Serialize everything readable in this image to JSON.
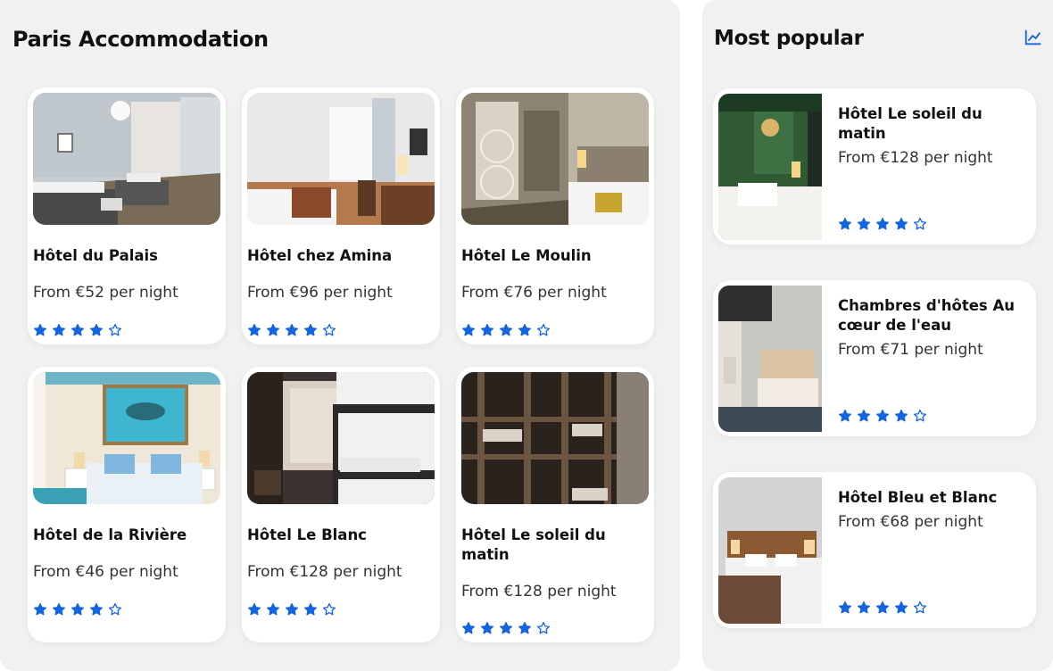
{
  "accent_color": "#1565e0",
  "main": {
    "title": "Paris Accommodation",
    "hotels": [
      {
        "name": "Hôtel du Palais",
        "price": "From €52 per night",
        "rating": 4,
        "max_rating": 5
      },
      {
        "name": "Hôtel chez Amina",
        "price": "From €96 per night",
        "rating": 4,
        "max_rating": 5
      },
      {
        "name": "Hôtel Le Moulin",
        "price": "From €76 per night",
        "rating": 4,
        "max_rating": 5
      },
      {
        "name": "Hôtel de la Rivière",
        "price": "From €46 per night",
        "rating": 4,
        "max_rating": 5
      },
      {
        "name": "Hôtel Le Blanc",
        "price": "From €128 per night",
        "rating": 4,
        "max_rating": 5
      },
      {
        "name": "Hôtel Le soleil du matin",
        "price": "From €128 per night",
        "rating": 4,
        "max_rating": 5
      }
    ]
  },
  "sidebar": {
    "title": "Most popular",
    "icon": "trending-chart-icon",
    "hotels": [
      {
        "name": "Hôtel Le soleil du matin",
        "price": "From €128 per night",
        "rating": 4,
        "max_rating": 5
      },
      {
        "name": "Chambres d'hôtes Au cœur de l'eau",
        "price": "From €71 per night",
        "rating": 4,
        "max_rating": 5
      },
      {
        "name": "Hôtel Bleu et Blanc",
        "price": "From €68 per night",
        "rating": 4,
        "max_rating": 5
      }
    ]
  }
}
